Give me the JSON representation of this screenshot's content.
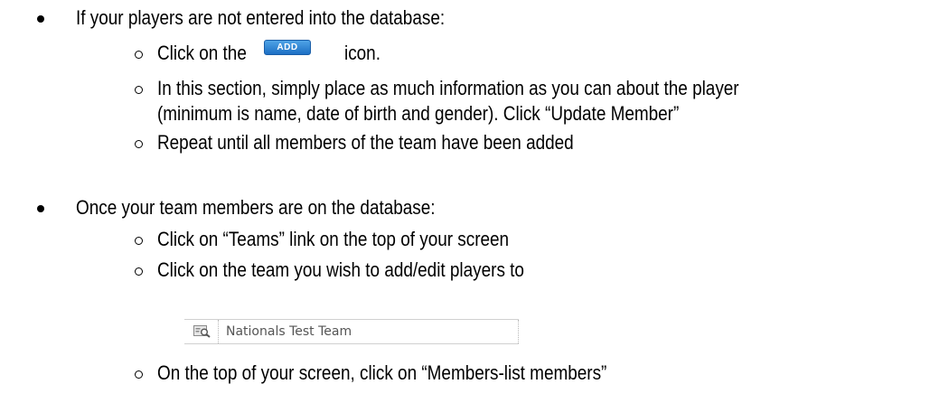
{
  "section1": {
    "heading": "If your players are not entered into the database:",
    "step_click_prefix": "Click on the",
    "step_click_suffix": "icon.",
    "add_button_label": "ADD",
    "step_info_line1": "In this section, simply place as much information as you can about the player",
    "step_info_line2": "(minimum is name, date of birth and gender). Click “Update Member”",
    "step_repeat": "Repeat until all members of the team have been added"
  },
  "section2": {
    "heading": "Once your team members are on the database:",
    "step_teams": "Click on “Teams” link on the top of your screen",
    "step_team": "Click on the team you wish to add/edit players to",
    "team_name": "Nationals Test Team",
    "step_members": "On the top of your screen, click on “Members-list members”"
  },
  "colors": {
    "text": "#000000",
    "add_button_top": "#4fa3e6",
    "add_button_bottom": "#1c6fc4",
    "team_text": "#555555"
  },
  "icons": {
    "team_icon": "magnifier-card-icon"
  }
}
